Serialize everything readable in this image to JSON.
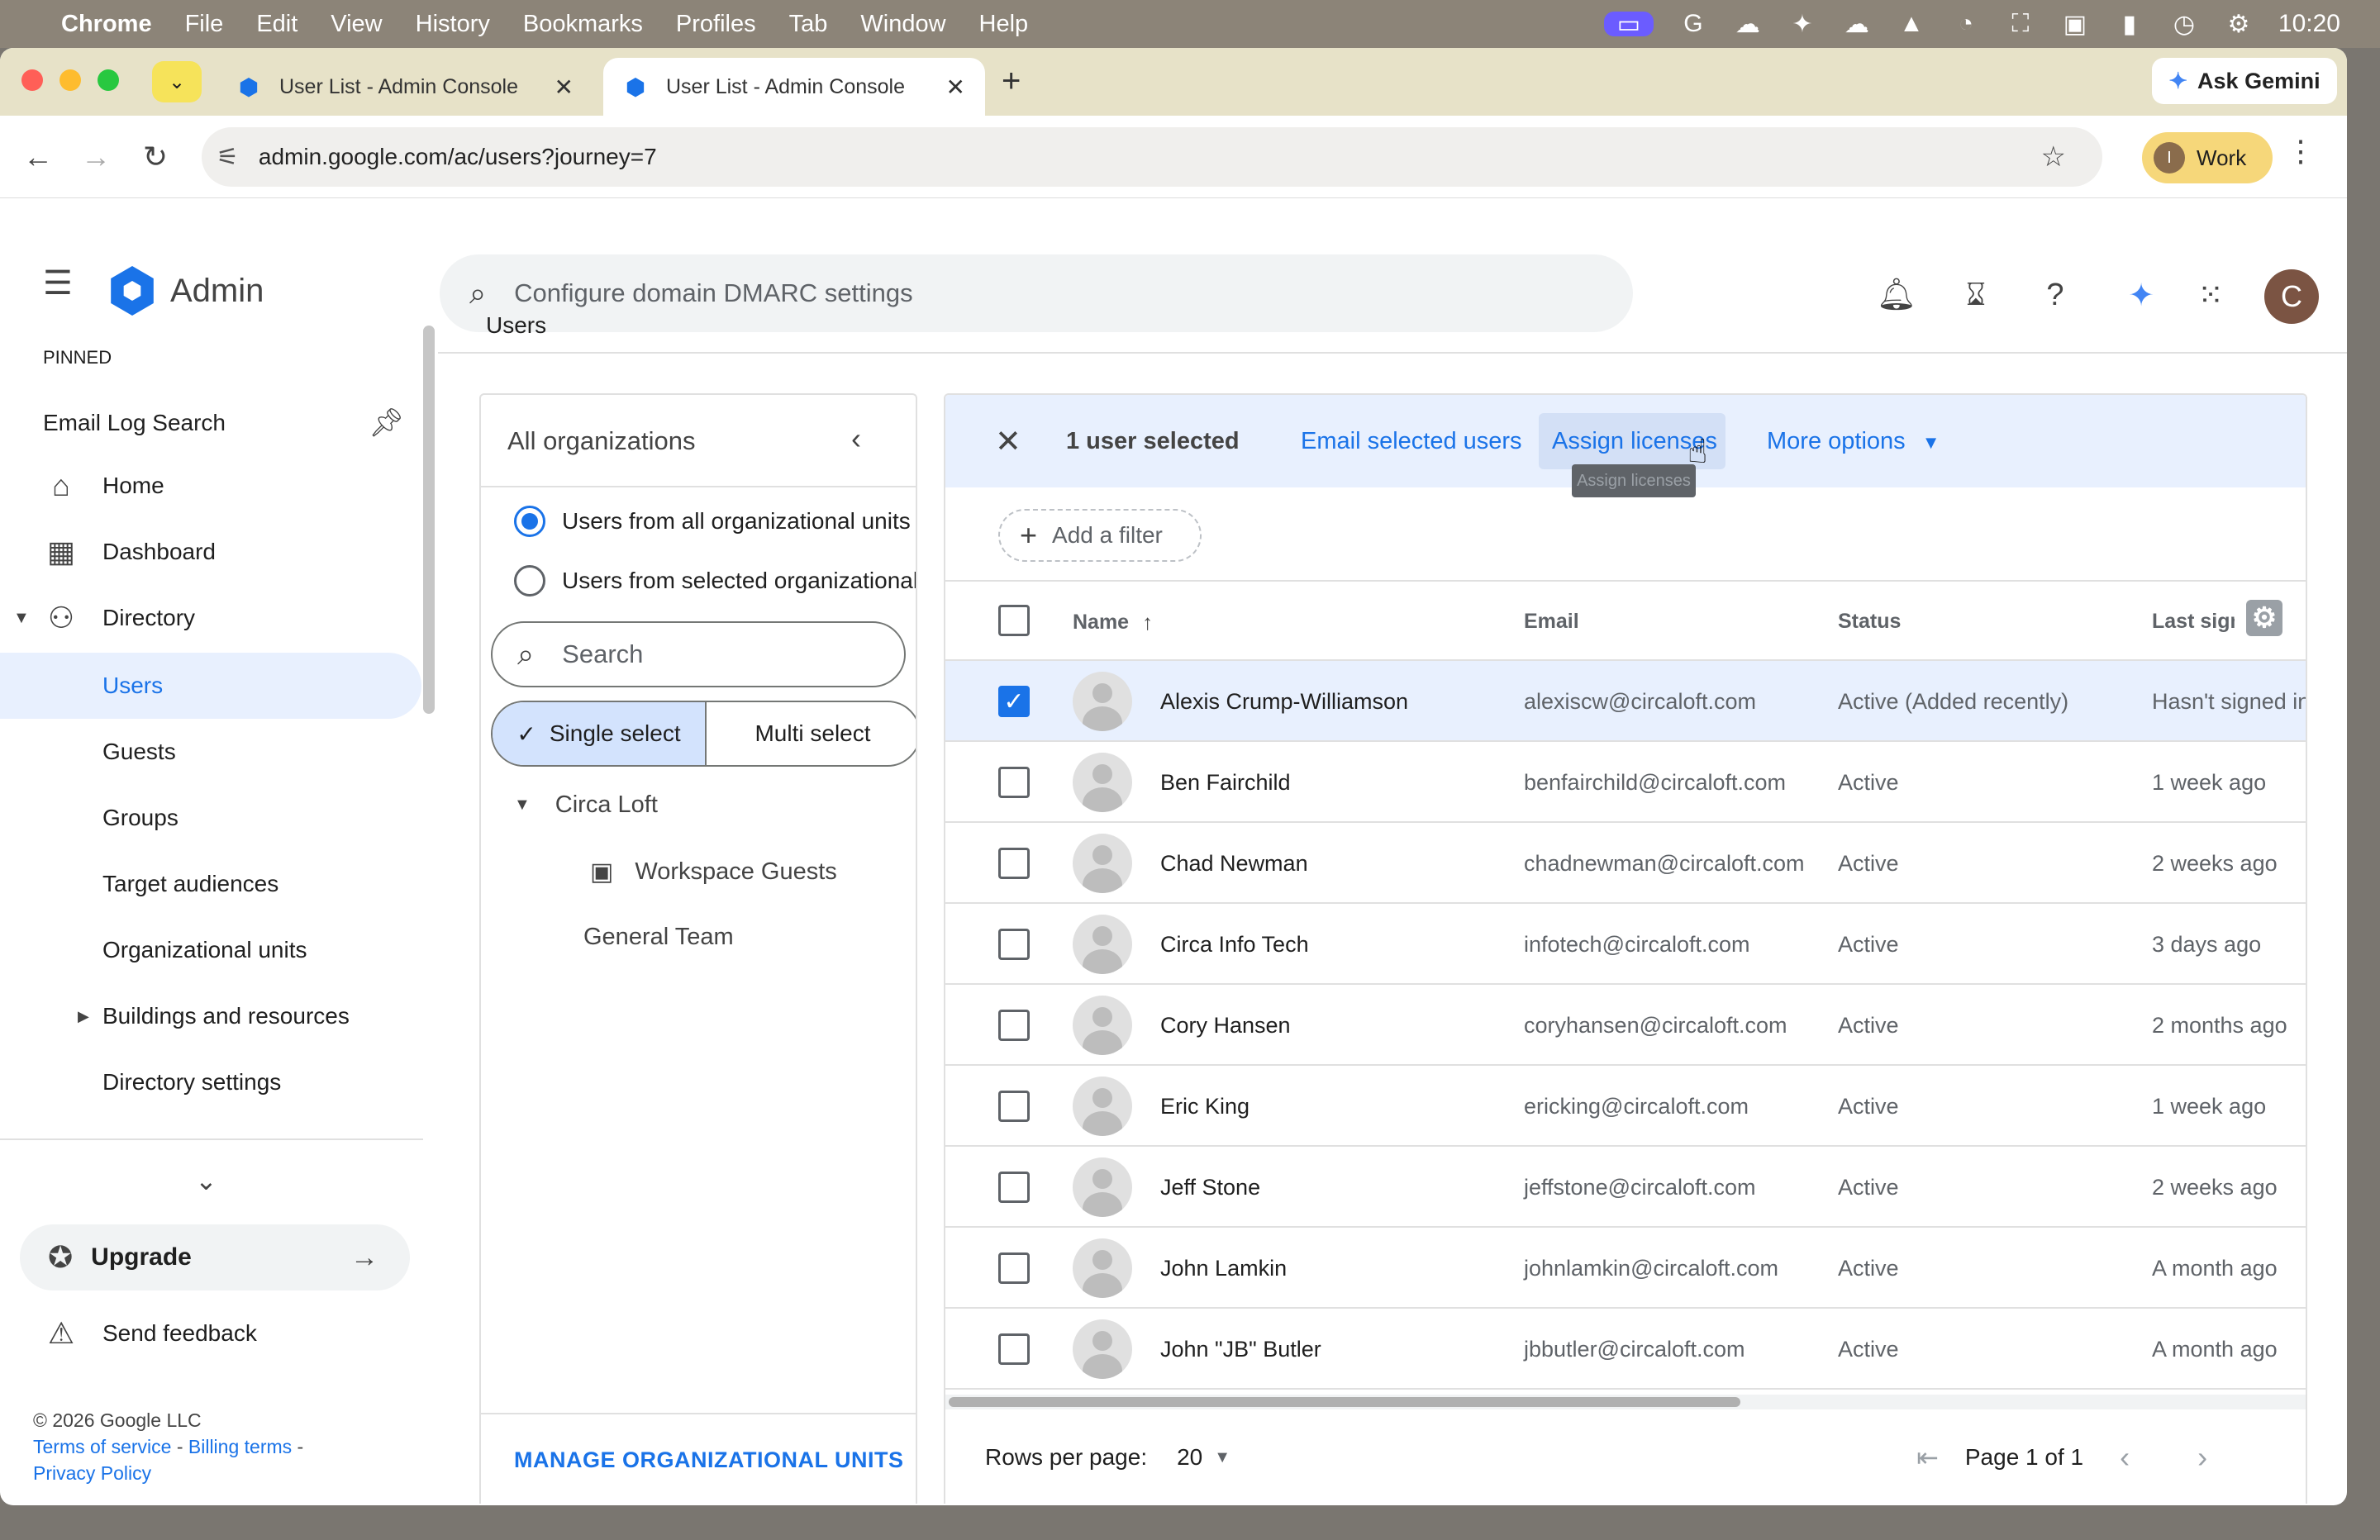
{
  "menubar": {
    "apple": "",
    "app": "Chrome",
    "items": [
      "File",
      "Edit",
      "View",
      "History",
      "Bookmarks",
      "Profiles",
      "Tab",
      "Window",
      "Help"
    ],
    "clock": "10:20"
  },
  "browser": {
    "tabs": [
      {
        "title": "User List - Admin Console"
      },
      {
        "title": "User List - Admin Console"
      }
    ],
    "gemini_label": "Ask Gemini",
    "url": "admin.google.com/ac/users?journey=7",
    "profile_label": "Work",
    "profile_initial": "I"
  },
  "admin": {
    "logo_text": "Admin",
    "search_placeholder": "Configure domain DMARC settings",
    "avatar_initial": "C",
    "breadcrumb": "Users"
  },
  "sidebar": {
    "pinned_heading": "PINNED",
    "pinned_item": "Email Log Search",
    "items": [
      {
        "label": "Home"
      },
      {
        "label": "Dashboard"
      },
      {
        "label": "Directory"
      },
      {
        "label": "Users"
      },
      {
        "label": "Guests"
      },
      {
        "label": "Groups"
      },
      {
        "label": "Target audiences"
      },
      {
        "label": "Organizational units"
      },
      {
        "label": "Buildings and resources"
      },
      {
        "label": "Directory settings"
      }
    ],
    "upgrade_label": "Upgrade",
    "feedback_label": "Send feedback",
    "copyright": "© 2026 Google LLC",
    "terms": "Terms of service",
    "billing": "Billing terms",
    "privacy": "Privacy Policy"
  },
  "orgs": {
    "title": "All organizations",
    "radio_all": "Users from all organizational units",
    "radio_selected": "Users from selected organizational units",
    "search_placeholder": "Search",
    "single_select": "Single select",
    "multi_select": "Multi select",
    "tree": [
      {
        "label": "Circa Loft"
      },
      {
        "label": "Workspace Guests"
      },
      {
        "label": "General Team"
      }
    ],
    "manage_label": "MANAGE ORGANIZATIONAL UNITS"
  },
  "users": {
    "selected_count": "1 user selected",
    "email_selected": "Email selected users",
    "assign_licenses": "Assign licenses",
    "tooltip": "Assign licenses",
    "more_options": "More options",
    "add_filter": "Add a filter",
    "columns": {
      "name": "Name",
      "email": "Email",
      "status": "Status",
      "last_sign_in": "Last sign in"
    },
    "rows": [
      {
        "name": "Alexis Crump-Williamson",
        "email": "alexiscw@circaloft.com",
        "status": "Active (Added recently)",
        "last": "Hasn't signed in",
        "selected": true
      },
      {
        "name": "Ben Fairchild",
        "email": "benfairchild@circaloft.com",
        "status": "Active",
        "last": "1 week ago",
        "selected": false
      },
      {
        "name": "Chad Newman",
        "email": "chadnewman@circaloft.com",
        "status": "Active",
        "last": "2 weeks ago",
        "selected": false
      },
      {
        "name": "Circa Info Tech",
        "email": "infotech@circaloft.com",
        "status": "Active",
        "last": "3 days ago",
        "selected": false
      },
      {
        "name": "Cory Hansen",
        "email": "coryhansen@circaloft.com",
        "status": "Active",
        "last": "2 months ago",
        "selected": false
      },
      {
        "name": "Eric King",
        "email": "ericking@circaloft.com",
        "status": "Active",
        "last": "1 week ago",
        "selected": false
      },
      {
        "name": "Jeff Stone",
        "email": "jeffstone@circaloft.com",
        "status": "Active",
        "last": "2 weeks ago",
        "selected": false
      },
      {
        "name": "John Lamkin",
        "email": "johnlamkin@circaloft.com",
        "status": "Active",
        "last": "A month ago",
        "selected": false
      },
      {
        "name": "John \"JB\" Butler",
        "email": "jbbutler@circaloft.com",
        "status": "Active",
        "last": "A month ago",
        "selected": false
      }
    ],
    "rows_per_page_label": "Rows per page:",
    "rows_per_page_value": "20",
    "page_label": "Page 1 of 1"
  }
}
